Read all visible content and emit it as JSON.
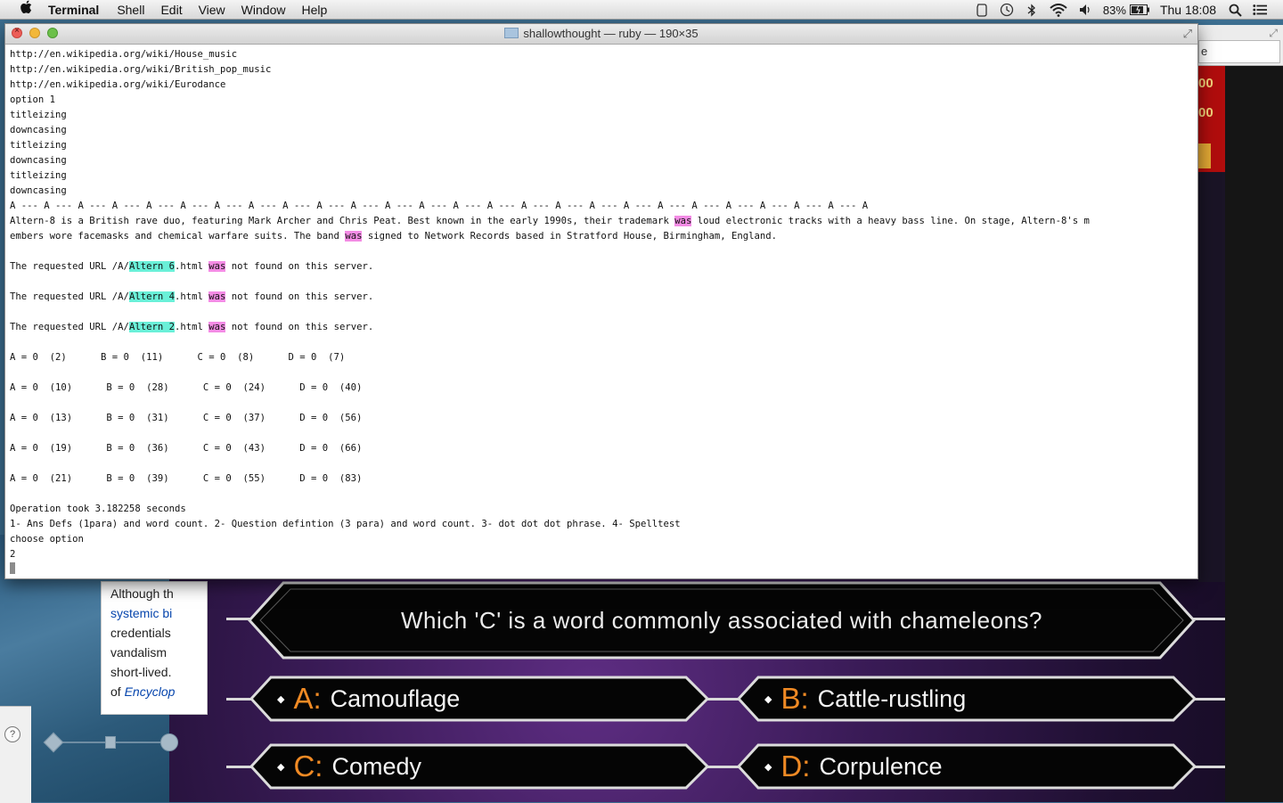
{
  "menubar": {
    "app": "Terminal",
    "items": [
      "Shell",
      "Edit",
      "View",
      "Window",
      "Help"
    ],
    "battery": "83%",
    "clock": "Thu 18:08"
  },
  "terminal": {
    "title": "shallowthought — ruby — 190×35",
    "lines": [
      "http://en.wikipedia.org/wiki/House_music",
      "http://en.wikipedia.org/wiki/British_pop_music",
      "http://en.wikipedia.org/wiki/Eurodance",
      "option 1",
      "titleizing",
      "downcasing",
      "titleizing",
      "downcasing",
      "titleizing",
      "downcasing",
      "A --- A --- A --- A --- A --- A --- A --- A --- A --- A --- A --- A --- A --- A --- A --- A --- A --- A --- A --- A --- A --- A --- A --- A --- A --- A",
      "Altern-8 is a British rave duo, featuring Mark Archer and Chris Peat. Best known in the early 1990s, their trademark [[was]] loud electronic tracks with a heavy bass line. On stage, Altern-8's m",
      "embers wore facemasks and chemical warfare suits. The band [[was]] signed to Network Records based in Stratford House, Birmingham, England.",
      "",
      "The requested URL /A/{{Altern 6}}.html [[was]] not found on this server.",
      "",
      "The requested URL /A/{{Altern 4}}.html [[was]] not found on this server.",
      "",
      "The requested URL /A/{{Altern 2}}.html [[was]] not found on this server.",
      "",
      "A = 0  (2)      B = 0  (11)      C = 0  (8)      D = 0  (7)",
      "",
      "A = 0  (10)      B = 0  (28)      C = 0  (24)      D = 0  (40)",
      "",
      "A = 0  (13)      B = 0  (31)      C = 0  (37)      D = 0  (56)",
      "",
      "A = 0  (19)      B = 0  (36)      C = 0  (43)      D = 0  (66)",
      "",
      "A = 0  (21)      B = 0  (39)      C = 0  (55)      D = 0  (83)",
      "",
      "Operation took 3.182258 seconds",
      "1- Ans Defs (1para) and word count. 2- Question defintion (3 para) and word count. 3- dot dot dot phrase. 4- Spelltest",
      "choose option",
      "2"
    ]
  },
  "wiki": {
    "lines": [
      "Although th",
      "systemic bi",
      "credentials",
      "vandalism",
      "short-lived.",
      "of "
    ],
    "last_link": "Encyclop"
  },
  "browser_field": "e",
  "money": [
    "00",
    "00"
  ],
  "quiz": {
    "question": "Which 'C' is a word commonly associated with chameleons?",
    "answers": [
      {
        "letter": "A:",
        "text": "Camouflage"
      },
      {
        "letter": "B:",
        "text": "Cattle-rustling"
      },
      {
        "letter": "C:",
        "text": "Comedy"
      },
      {
        "letter": "D:",
        "text": "Corpulence"
      }
    ]
  },
  "colors": {
    "highlight_cyan": "#6af0d8",
    "highlight_pink": "#f48ce5",
    "answer_letter": "#f08a24"
  }
}
